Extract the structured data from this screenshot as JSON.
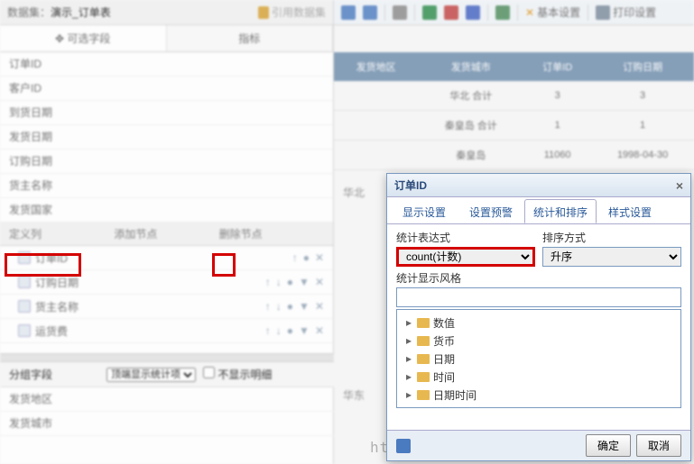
{
  "dataset": {
    "label": "数据集：",
    "name": "演示_订单表",
    "import_btn": "引用数据集"
  },
  "left_tabs": {
    "optional": "✥ 可选字段",
    "indicator": "指标"
  },
  "fields": [
    "订单ID",
    "客户ID",
    "到货日期",
    "发货日期",
    "订购日期",
    "货主名称",
    "发货国家"
  ],
  "custom_cols": {
    "header": "定义列",
    "add": "添加节点",
    "remove": "删除节点"
  },
  "tree_items": [
    "订单ID",
    "订购日期",
    "货主名称",
    "运货费"
  ],
  "group_section": {
    "label": "分组字段",
    "dropdown": "顶端显示统计项",
    "checkbox": "不显示明细"
  },
  "group_fields": [
    "发货地区",
    "发货城市"
  ],
  "toolbar": {
    "basic": "基本设置",
    "print": "打印设置"
  },
  "table": {
    "headers": [
      "发货地区",
      "发货城市",
      "订单ID",
      "订购日期"
    ],
    "rows": [
      [
        "",
        "华北 合计",
        "3",
        "3"
      ],
      [
        "",
        "秦皇岛 合计",
        "1",
        "1"
      ],
      [
        "",
        "秦皇岛",
        "11060",
        "1998-04-30"
      ]
    ],
    "side_labels": [
      "华北",
      "华东"
    ]
  },
  "dialog": {
    "title": "订单ID",
    "tabs": [
      "显示设置",
      "设置预警",
      "统计和排序",
      "样式设置"
    ],
    "active_tab": 2,
    "expr_label": "统计表达式",
    "expr_value": "count(计数)",
    "sort_label": "排序方式",
    "sort_value": "升序",
    "style_label": "统计显示风格",
    "style_value": "",
    "tree_nodes": [
      "数值",
      "货币",
      "日期",
      "时间",
      "日期时间"
    ],
    "ok": "确定",
    "cancel": "取消"
  },
  "watermark": "http://blog.csdn.net/guxiaohai博客"
}
